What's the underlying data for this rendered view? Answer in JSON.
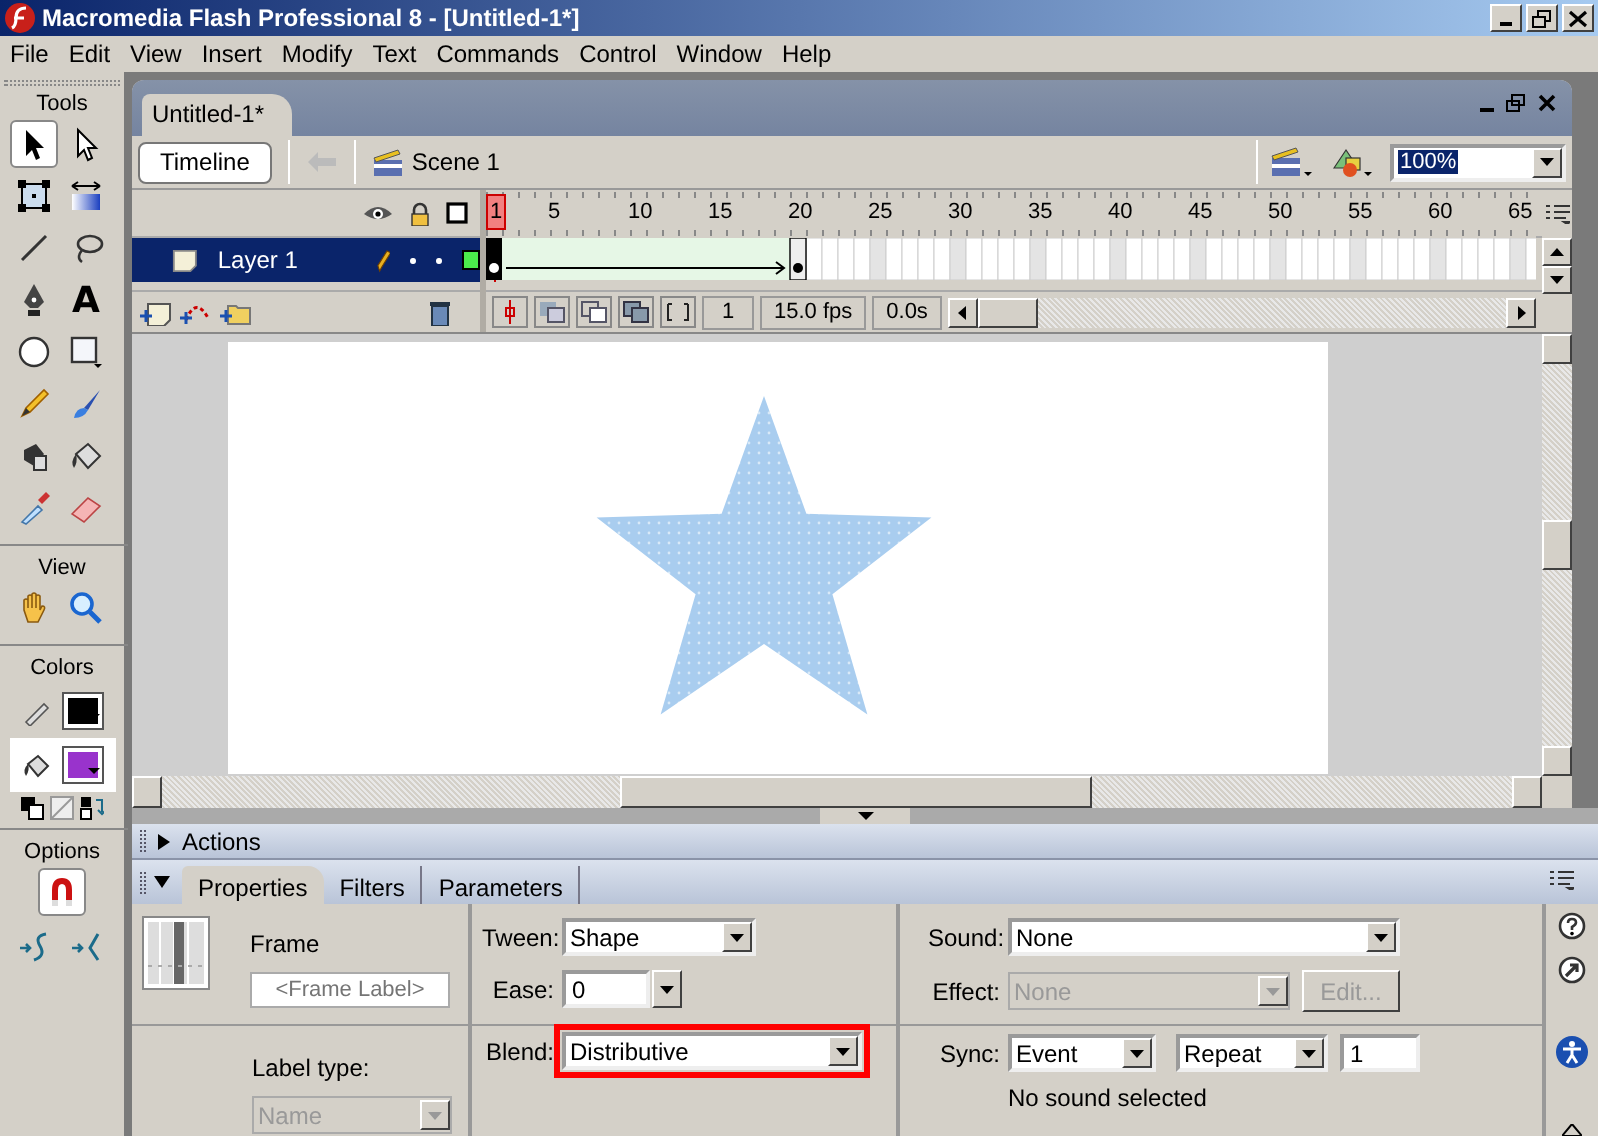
{
  "window": {
    "title": "Macromedia Flash Professional 8 - [Untitled-1*]"
  },
  "menu": [
    "File",
    "Edit",
    "View",
    "Insert",
    "Modify",
    "Text",
    "Commands",
    "Control",
    "Window",
    "Help"
  ],
  "tools": {
    "title": "Tools",
    "items": [
      {
        "kind": "arrow",
        "selected": true
      },
      {
        "kind": "subselect",
        "selected": false
      },
      {
        "kind": "transform",
        "selected": false
      },
      {
        "kind": "gradient",
        "selected": false
      },
      {
        "kind": "line",
        "selected": false
      },
      {
        "kind": "lasso",
        "selected": false
      },
      {
        "kind": "pen",
        "selected": false
      },
      {
        "kind": "text",
        "glyph": "A",
        "selected": false
      },
      {
        "kind": "oval",
        "selected": false
      },
      {
        "kind": "rect",
        "selected": false
      },
      {
        "kind": "pencil",
        "selected": false
      },
      {
        "kind": "brush",
        "selected": false
      },
      {
        "kind": "inkbottle",
        "selected": false
      },
      {
        "kind": "bucket",
        "selected": false
      },
      {
        "kind": "dropper",
        "selected": false
      },
      {
        "kind": "eraser",
        "selected": false
      }
    ]
  },
  "view": {
    "title": "View",
    "items": [
      {
        "kind": "hand",
        "selected": false
      },
      {
        "kind": "zoom",
        "selected": false
      }
    ]
  },
  "colors": {
    "title": "Colors",
    "swatches": [
      {
        "kind": "stroke",
        "color": "#000000",
        "selected": false
      },
      {
        "kind": "fill",
        "color": "#9933cc",
        "selected": true
      }
    ]
  },
  "options": {
    "title": "Options",
    "items": [
      {
        "kind": "magnet",
        "on": true
      },
      {
        "kind": "smooth",
        "on": false
      },
      {
        "kind": "straighten",
        "on": false
      }
    ]
  },
  "document": {
    "tab": "Untitled-1*",
    "timeline_button": "Timeline",
    "scene": "Scene 1",
    "zoom": "100%"
  },
  "timeline": {
    "frame_numbers": [
      "1",
      "5",
      "10",
      "15",
      "20",
      "25",
      "30",
      "35",
      "40",
      "45",
      "50",
      "55",
      "60",
      "65"
    ],
    "layers": [
      {
        "name": "Layer 1",
        "selected": true,
        "kind": "shape_tween"
      }
    ],
    "current_frame": "1",
    "frame_rate": "15.0 fps",
    "elapsed_time": "0.0s"
  },
  "actions_panel": {
    "title": "Actions",
    "expanded": false
  },
  "properties_panel": {
    "expanded": true,
    "tabs": [
      {
        "label": "Properties",
        "selected": true
      },
      {
        "label": "Filters",
        "selected": false
      },
      {
        "label": "Parameters",
        "selected": false
      }
    ],
    "frame_heading": "Frame",
    "frame_label": {
      "placeholder": "<Frame Label>"
    },
    "label_type": {
      "label": "Label type:",
      "value": "Name",
      "disabled": true
    },
    "tween": {
      "label": "Tween:",
      "value": "Shape"
    },
    "ease": {
      "label": "Ease:",
      "value": "0"
    },
    "blend": {
      "label": "Blend:",
      "value": "Distributive",
      "highlighted": true
    },
    "sound": {
      "label": "Sound:",
      "value": "None"
    },
    "effect": {
      "label": "Effect:",
      "value": "None",
      "disabled": true
    },
    "edit_button": {
      "label": "Edit...",
      "disabled": true
    },
    "sync": {
      "label": "Sync:",
      "value": "Event",
      "repeat": "Repeat",
      "count": "1"
    },
    "status": "No sound selected"
  }
}
